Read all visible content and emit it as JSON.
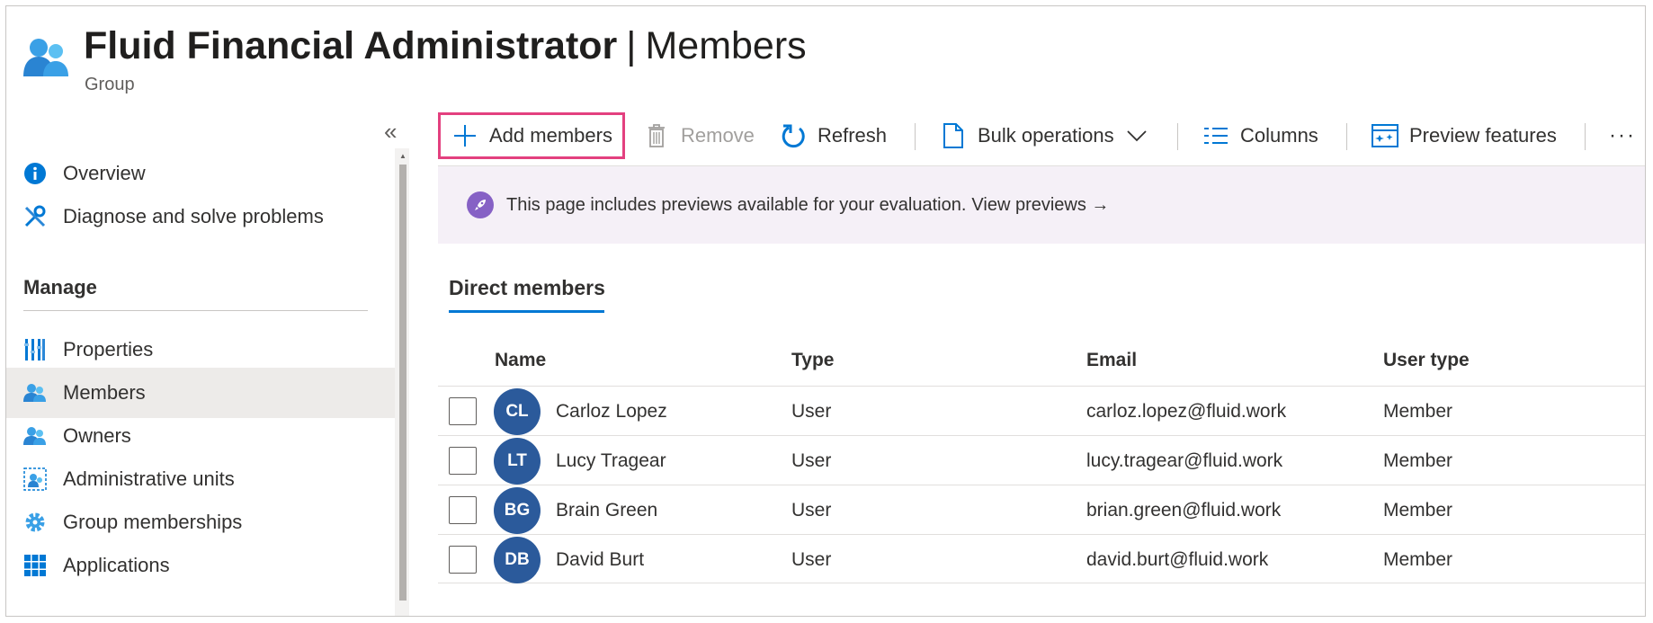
{
  "header": {
    "title_strong": "Fluid Financial Administrator",
    "title_sep": "|",
    "title_light": "Members",
    "subtitle": "Group"
  },
  "sidebar": {
    "collapse_glyph": "«",
    "items_top": [
      {
        "label": "Overview",
        "icon": "info-icon"
      },
      {
        "label": "Diagnose and solve problems",
        "icon": "wrench-icon"
      }
    ],
    "section_title": "Manage",
    "items_manage": [
      {
        "label": "Properties",
        "icon": "properties-icon"
      },
      {
        "label": "Members",
        "icon": "members-icon",
        "active": true
      },
      {
        "label": "Owners",
        "icon": "owners-icon"
      },
      {
        "label": "Administrative units",
        "icon": "admin-units-icon"
      },
      {
        "label": "Group memberships",
        "icon": "gear-icon"
      },
      {
        "label": "Applications",
        "icon": "grid-icon"
      }
    ]
  },
  "toolbar": {
    "add_members": "Add members",
    "remove": "Remove",
    "refresh": "Refresh",
    "bulk_operations": "Bulk operations",
    "columns": "Columns",
    "preview_features": "Preview features",
    "more": "···"
  },
  "banner": {
    "text": "This page includes previews available for your evaluation.",
    "link": "View previews →"
  },
  "tabs": {
    "direct_members": "Direct members"
  },
  "table": {
    "headers": [
      "Name",
      "Type",
      "Email",
      "User type"
    ],
    "rows": [
      {
        "initials": "CL",
        "name": "Carloz Lopez",
        "type": "User",
        "email": "carloz.lopez@fluid.work",
        "user_type": "Member"
      },
      {
        "initials": "LT",
        "name": "Lucy Tragear",
        "type": "User",
        "email": "lucy.tragear@fluid.work",
        "user_type": "Member"
      },
      {
        "initials": "BG",
        "name": "Brain Green",
        "type": "User",
        "email": "brian.green@fluid.work",
        "user_type": "Member"
      },
      {
        "initials": "DB",
        "name": "David Burt",
        "type": "User",
        "email": "david.burt@fluid.work",
        "user_type": "Member"
      }
    ]
  },
  "colors": {
    "accent": "#0078d4",
    "highlight_border": "#e3407f",
    "avatar": "#2b5a9b",
    "banner_bg": "#f5f0f7",
    "banner_icon": "#8661c5"
  }
}
